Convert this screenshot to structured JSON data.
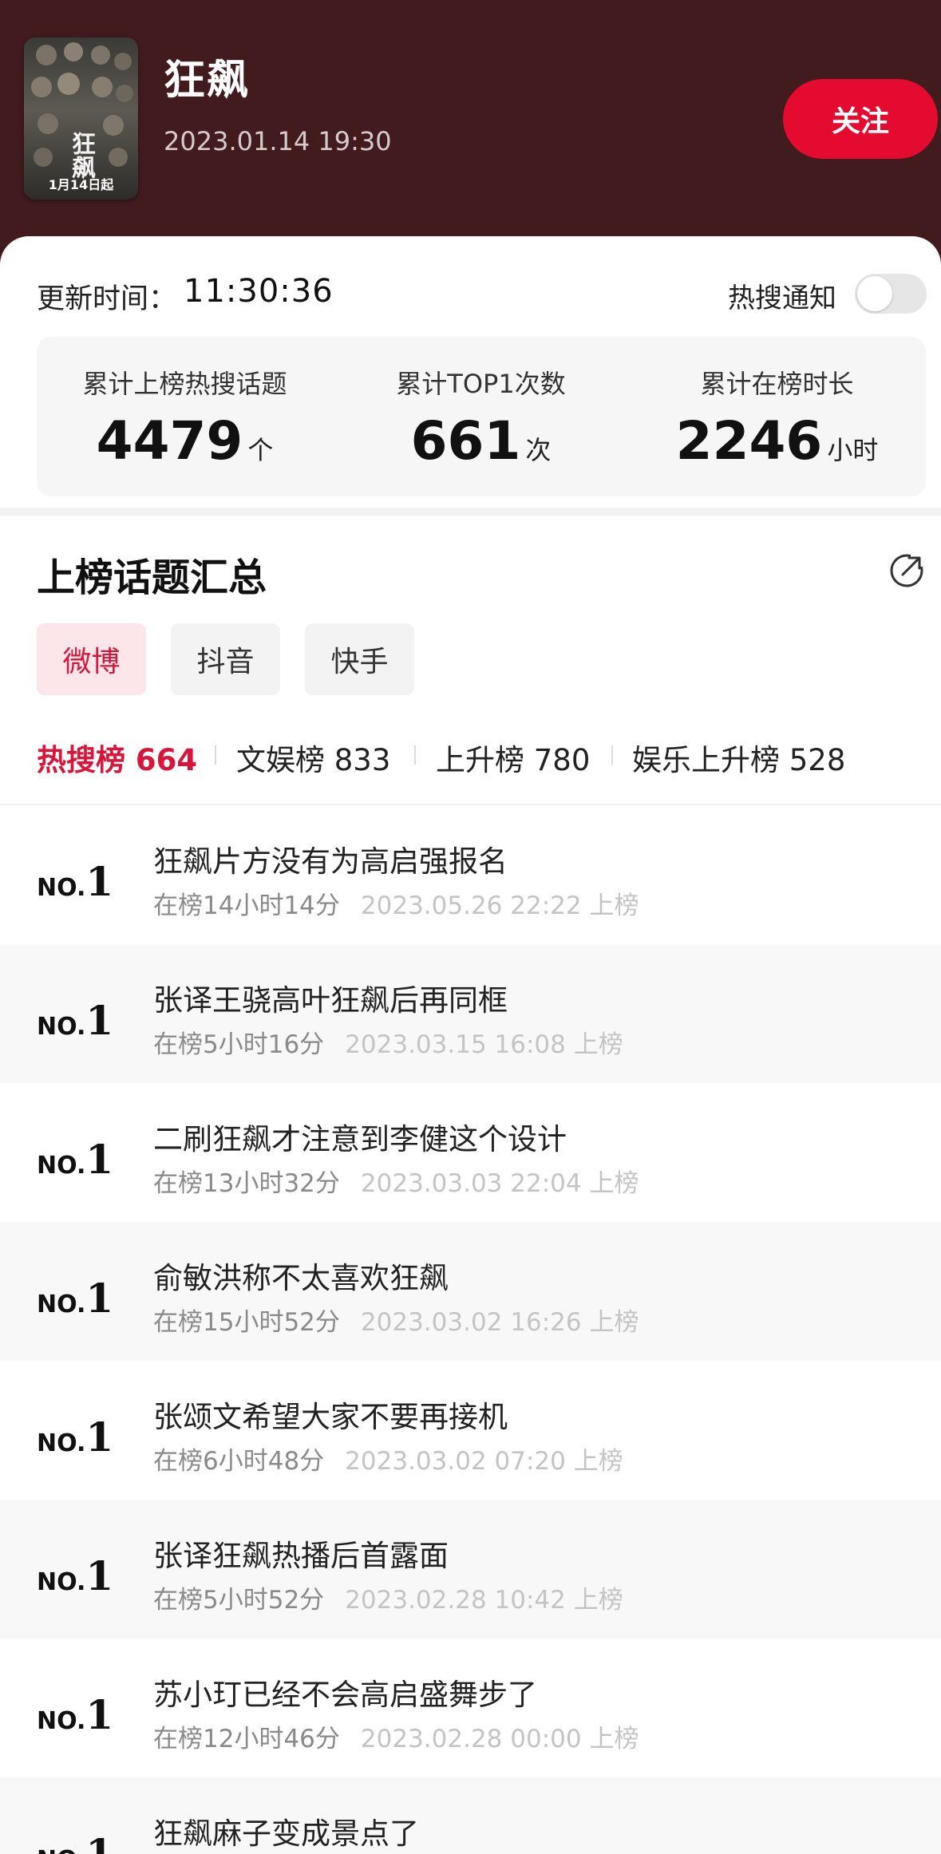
{
  "header": {
    "title": "狂飙",
    "time": "2023.01.14 19:30",
    "follow_label": "关注",
    "poster_title": "狂飙",
    "poster_date": "1月14日起"
  },
  "status": {
    "update_label": "更新时间：",
    "update_time": "11:30:36",
    "notify_label": "热搜通知",
    "notify_enabled": false
  },
  "stats": [
    {
      "label": "累计上榜热搜话题",
      "value": "4479",
      "unit": "个"
    },
    {
      "label": "累计TOP1次数",
      "value": "661",
      "unit": "次"
    },
    {
      "label": "累计在榜时长",
      "value": "2246",
      "unit": "小时"
    }
  ],
  "section": {
    "title": "上榜话题汇总",
    "share_icon": "share-icon"
  },
  "platforms": [
    {
      "label": "微博",
      "active": true
    },
    {
      "label": "抖音",
      "active": false
    },
    {
      "label": "快手",
      "active": false
    }
  ],
  "rank_tabs": [
    {
      "label": "热搜榜 664",
      "active": true
    },
    {
      "label": "文娱榜 833",
      "active": false
    },
    {
      "label": "上升榜 780",
      "active": false
    },
    {
      "label": "娱乐上升榜 528",
      "active": false
    }
  ],
  "topics": [
    {
      "rank_prefix": "NO.",
      "rank": "1",
      "title": "狂飙片方没有为高启强报名",
      "duration": "在榜14小时14分",
      "date": "2023.05.26 22:22 上榜"
    },
    {
      "rank_prefix": "NO.",
      "rank": "1",
      "title": "张译王骁高叶狂飙后再同框",
      "duration": "在榜5小时16分",
      "date": "2023.03.15 16:08 上榜"
    },
    {
      "rank_prefix": "NO.",
      "rank": "1",
      "title": "二刷狂飙才注意到李健这个设计",
      "duration": "在榜13小时32分",
      "date": "2023.03.03 22:04 上榜"
    },
    {
      "rank_prefix": "NO.",
      "rank": "1",
      "title": "俞敏洪称不太喜欢狂飙",
      "duration": "在榜15小时52分",
      "date": "2023.03.02 16:26 上榜"
    },
    {
      "rank_prefix": "NO.",
      "rank": "1",
      "title": "张颂文希望大家不要再接机",
      "duration": "在榜6小时48分",
      "date": "2023.03.02 07:20 上榜"
    },
    {
      "rank_prefix": "NO.",
      "rank": "1",
      "title": "张译狂飙热播后首露面",
      "duration": "在榜5小时52分",
      "date": "2023.02.28 10:42 上榜"
    },
    {
      "rank_prefix": "NO.",
      "rank": "1",
      "title": "苏小玎已经不会高启盛舞步了",
      "duration": "在榜12小时46分",
      "date": "2023.02.28 00:00 上榜"
    },
    {
      "rank_prefix": "NO.",
      "rank": "1",
      "title": "狂飙麻子变成景点了",
      "duration": "",
      "date": ""
    }
  ]
}
